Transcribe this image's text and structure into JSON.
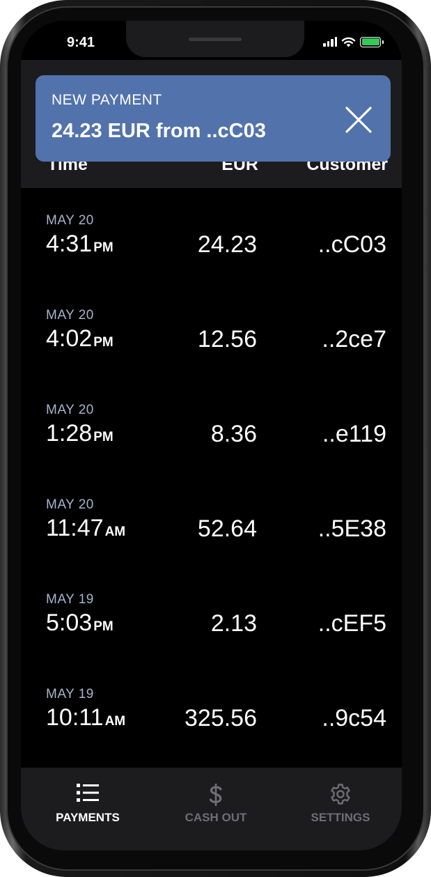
{
  "status_bar": {
    "time": "9:41"
  },
  "table_header": {
    "time": "Time",
    "eur": "EUR",
    "customer": "Customer"
  },
  "notification": {
    "title": "NEW PAYMENT",
    "message": "24.23 EUR from ..cC03"
  },
  "payments": [
    {
      "date": "MAY 20",
      "time": "4:31",
      "ampm": "PM",
      "eur": "24.23",
      "customer": "..cC03"
    },
    {
      "date": "MAY 20",
      "time": "4:02",
      "ampm": "PM",
      "eur": "12.56",
      "customer": "..2ce7"
    },
    {
      "date": "MAY 20",
      "time": "1:28",
      "ampm": "PM",
      "eur": "8.36",
      "customer": "..e119"
    },
    {
      "date": "MAY 20",
      "time": "11:47",
      "ampm": "AM",
      "eur": "52.64",
      "customer": "..5E38"
    },
    {
      "date": "MAY 19",
      "time": "5:03",
      "ampm": "PM",
      "eur": "2.13",
      "customer": "..cEF5"
    },
    {
      "date": "MAY 19",
      "time": "10:11",
      "ampm": "AM",
      "eur": "325.56",
      "customer": "..9c54"
    }
  ],
  "tabs": [
    {
      "label": "PAYMENTS",
      "icon": "list-icon",
      "active": true
    },
    {
      "label": "CASH OUT",
      "icon": "dollar-icon",
      "active": false
    },
    {
      "label": "SETTINGS",
      "icon": "gear-icon",
      "active": false
    }
  ],
  "colors": {
    "banner": "#5272ab",
    "date_text": "#a7b4cf",
    "battery": "#34c759",
    "tab_inactive": "#6e6e73",
    "surface": "#1c1c1e"
  }
}
